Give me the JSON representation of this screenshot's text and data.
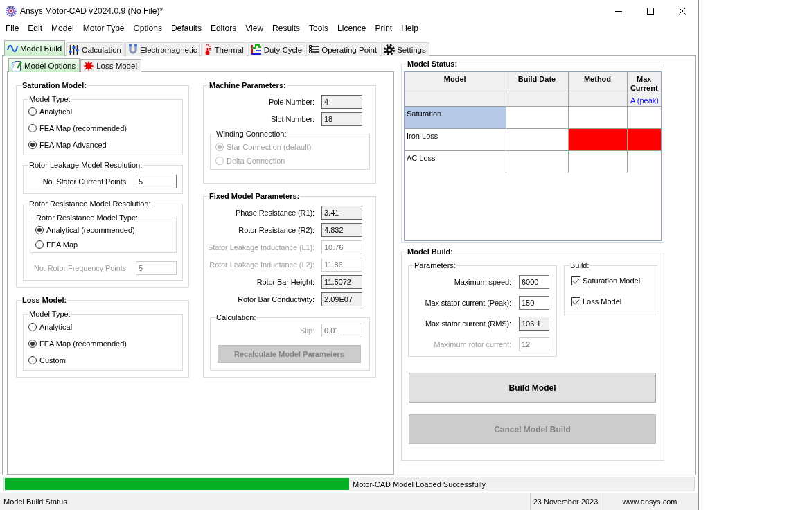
{
  "window": {
    "title": "Ansys Motor-CAD v2024.0.9 (No File)*"
  },
  "menu": [
    "File",
    "Edit",
    "Model",
    "Motor Type",
    "Options",
    "Defaults",
    "Editors",
    "View",
    "Results",
    "Tools",
    "Licence",
    "Print",
    "Help"
  ],
  "tabs": [
    {
      "label": "Model Build",
      "selected": true
    },
    {
      "label": "Calculation",
      "selected": false
    },
    {
      "label": "Electromagnetic",
      "selected": false
    },
    {
      "label": "Thermal",
      "selected": false
    },
    {
      "label": "Duty Cycle",
      "selected": false
    },
    {
      "label": "Operating Point",
      "selected": false
    },
    {
      "label": "Settings",
      "selected": false
    }
  ],
  "sub_tabs": [
    {
      "label": "Model Options",
      "selected": true
    },
    {
      "label": "Loss Model",
      "selected": false
    }
  ],
  "saturation_model": {
    "title": "Saturation Model:",
    "model_type": {
      "title": "Model Type:",
      "options": [
        {
          "label": "Analytical",
          "selected": false,
          "disabled": false
        },
        {
          "label": "FEA Map (recommended)",
          "selected": false,
          "disabled": false
        },
        {
          "label": "FEA Map Advanced",
          "selected": true,
          "disabled": false
        }
      ]
    },
    "rotor_leakage_resolution": {
      "title": "Rotor Leakage Model Resolution:",
      "field": {
        "label": "No. Stator Current Points:",
        "value": "5",
        "read_only": false,
        "disabled": false
      }
    },
    "rotor_resistance_resolution": {
      "title": "Rotor Resistance Model Resolution:",
      "model_type": {
        "title": "Rotor Resistance Model Type:",
        "options": [
          {
            "label": "Analytical (recommended)",
            "selected": true,
            "disabled": false
          },
          {
            "label": "FEA Map",
            "selected": false,
            "disabled": false
          }
        ]
      },
      "field": {
        "label": "No. Rotor Frequency Points:",
        "value": "5",
        "read_only": false,
        "disabled": true
      }
    }
  },
  "loss_model": {
    "title": "Loss Model:",
    "model_type": {
      "title": "Model Type:",
      "options": [
        {
          "label": "Analytical",
          "selected": false,
          "disabled": false
        },
        {
          "label": "FEA Map (recommended)",
          "selected": true,
          "disabled": false
        },
        {
          "label": "Custom",
          "selected": false,
          "disabled": false
        }
      ]
    }
  },
  "machine_parameters": {
    "title": "Machine Parameters:",
    "fields": [
      {
        "label": "Pole Number:",
        "value": "4",
        "read_only": true,
        "disabled": false
      },
      {
        "label": "Slot Number:",
        "value": "18",
        "read_only": true,
        "disabled": false
      }
    ],
    "winding_connection": {
      "title": "Winding Connection:",
      "options": [
        {
          "label": "Star Connection (default)",
          "selected": true,
          "disabled": true
        },
        {
          "label": "Delta Connection",
          "selected": false,
          "disabled": true
        }
      ]
    }
  },
  "fixed_model_parameters": {
    "title": "Fixed Model Parameters:",
    "fields": [
      {
        "label": "Phase Resistance (R1):",
        "value": "3.41",
        "read_only": true,
        "disabled": false
      },
      {
        "label": "Rotor Resistance (R2):",
        "value": "4.832",
        "read_only": true,
        "disabled": false
      },
      {
        "label": "Stator Leakage Inductance (L1):",
        "value": "10.76",
        "read_only": false,
        "disabled": true
      },
      {
        "label": "Rotor Leakage Inductance (L2):",
        "value": "11.86",
        "read_only": false,
        "disabled": true
      },
      {
        "label": "Rotor Bar Height:",
        "value": "11.5072",
        "read_only": true,
        "disabled": false
      },
      {
        "label": "Rotor Bar Conductivity:",
        "value": "2.09E07",
        "read_only": true,
        "disabled": false
      }
    ],
    "calculation": {
      "title": "Calculation:",
      "field": {
        "label": "Slip:",
        "value": "0.01",
        "read_only": false,
        "disabled": true
      },
      "button": {
        "label": "Recalculate Model Parameters",
        "disabled": true
      }
    }
  },
  "model_status": {
    "title": "Model Status:",
    "columns": [
      {
        "label": "Model"
      },
      {
        "label": "Build Date"
      },
      {
        "label": "Method"
      },
      {
        "label": "Max Current",
        "unit": "A (peak)"
      }
    ],
    "rows": [
      {
        "model": "Saturation",
        "selected": true,
        "flagged": false
      },
      {
        "model": "Iron Loss",
        "selected": false,
        "flagged": true
      },
      {
        "model": "AC Loss",
        "selected": false,
        "flagged": false
      }
    ]
  },
  "model_build": {
    "title": "Model Build:",
    "parameters": {
      "title": "Parameters:",
      "fields": [
        {
          "label": "Maximum speed:",
          "value": "6000",
          "read_only": false,
          "disabled": false
        },
        {
          "label": "Max stator current (Peak):",
          "value": "150",
          "read_only": false,
          "disabled": false
        },
        {
          "label": "Max stator current (RMS):",
          "value": "106.1",
          "read_only": true,
          "disabled": false
        },
        {
          "label": "Maximum rotor current:",
          "value": "12",
          "read_only": false,
          "disabled": true
        }
      ]
    },
    "build": {
      "title": "Build:",
      "options": [
        {
          "label": "Saturation Model",
          "checked": true
        },
        {
          "label": "Loss Model",
          "checked": true
        }
      ]
    },
    "buttons": [
      {
        "label": "Build Model",
        "disabled": false
      },
      {
        "label": "Cancel Model Build",
        "disabled": true
      }
    ]
  },
  "progress": {
    "level": 1,
    "message": "Motor-CAD Model Loaded Successfully"
  },
  "status_bar": [
    "Model Build Status",
    "23 November 2023",
    "www.ansys.com"
  ]
}
